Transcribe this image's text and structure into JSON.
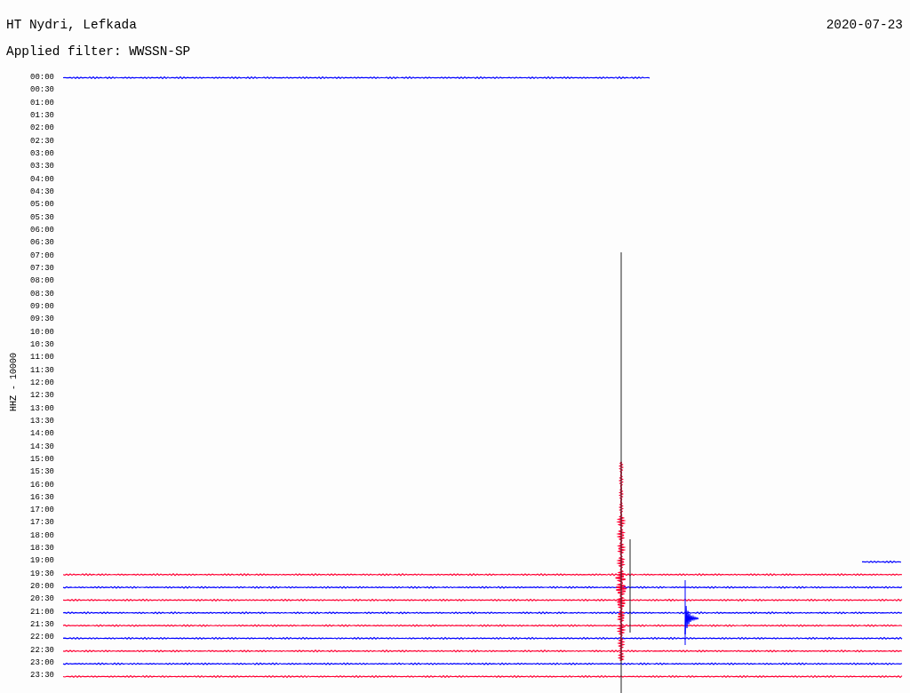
{
  "header": {
    "station": "HT Nydri, Lefkada",
    "date": "2020-07-23",
    "filter": "Applied filter: WWSSN-SP"
  },
  "axis_label": "HHZ - 10000",
  "rows": [
    {
      "time": "00:00",
      "kind": "start",
      "color": "#0000ff"
    },
    {
      "time": "00:30"
    },
    {
      "time": "01:00"
    },
    {
      "time": "01:30"
    },
    {
      "time": "02:00"
    },
    {
      "time": "02:30"
    },
    {
      "time": "03:00"
    },
    {
      "time": "03:30"
    },
    {
      "time": "04:00"
    },
    {
      "time": "04:30"
    },
    {
      "time": "05:00"
    },
    {
      "time": "05:30"
    },
    {
      "time": "06:00"
    },
    {
      "time": "06:30"
    },
    {
      "time": "07:00"
    },
    {
      "time": "07:30"
    },
    {
      "time": "08:00"
    },
    {
      "time": "08:30"
    },
    {
      "time": "09:00"
    },
    {
      "time": "09:30"
    },
    {
      "time": "10:00"
    },
    {
      "time": "10:30"
    },
    {
      "time": "11:00"
    },
    {
      "time": "11:30"
    },
    {
      "time": "12:00"
    },
    {
      "time": "12:30"
    },
    {
      "time": "13:00"
    },
    {
      "time": "13:30"
    },
    {
      "time": "14:00"
    },
    {
      "time": "14:30"
    },
    {
      "time": "15:00"
    },
    {
      "time": "15:30"
    },
    {
      "time": "16:00"
    },
    {
      "time": "16:30"
    },
    {
      "time": "17:00"
    },
    {
      "time": "17:30"
    },
    {
      "time": "18:00"
    },
    {
      "time": "18:30"
    },
    {
      "time": "19:00",
      "kind": "end",
      "color": "#0000ff"
    },
    {
      "time": "19:30",
      "kind": "full",
      "color": "#ff0033"
    },
    {
      "time": "20:00",
      "kind": "full",
      "color": "#0000ff"
    },
    {
      "time": "20:30",
      "kind": "full",
      "color": "#ff0033"
    },
    {
      "time": "21:00",
      "kind": "full",
      "color": "#0000ff"
    },
    {
      "time": "21:30",
      "kind": "full",
      "color": "#ff0033"
    },
    {
      "time": "22:00",
      "kind": "full",
      "color": "#0000ff"
    },
    {
      "time": "22:30",
      "kind": "full",
      "color": "#ff0033"
    },
    {
      "time": "23:00",
      "kind": "full",
      "color": "#0000ff"
    },
    {
      "time": "23:30",
      "kind": "full",
      "color": "#ff0033"
    }
  ]
}
